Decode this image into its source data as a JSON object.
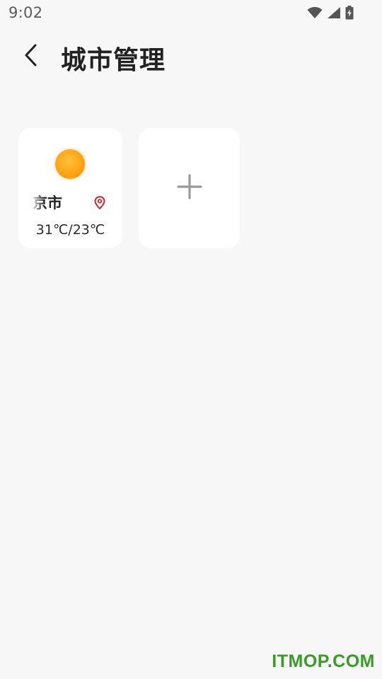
{
  "status_bar": {
    "time": "9:02",
    "icons": [
      "wifi-icon",
      "cell-signal-icon",
      "battery-charging-icon"
    ]
  },
  "header": {
    "back_icon": "chevron-left-icon",
    "title": "城市管理"
  },
  "cities": [
    {
      "name": "京市",
      "weather_icon": "sun-icon",
      "location_icon": "location-pin-icon",
      "temperature": "31℃/23℃",
      "colors": {
        "sun": "#ffa415",
        "location_pin": "#c62828"
      }
    }
  ],
  "add_card": {
    "icon": "plus-icon"
  },
  "watermark": "ITMOP.COM",
  "colors": {
    "background": "#f7f7f7",
    "card": "#ffffff",
    "watermark": "#3a9a2a"
  }
}
